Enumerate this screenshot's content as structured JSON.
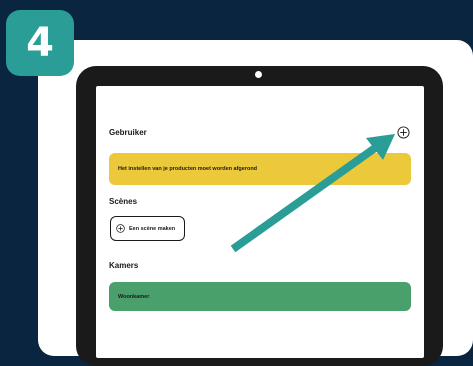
{
  "step": {
    "number": "4"
  },
  "screen": {
    "user_section_title": "Gebruiker",
    "setup_banner": "Het instellen van je producten moet worden afgerond",
    "scenes_title": "Scènes",
    "create_scene_label": "Een scène maken",
    "rooms_title": "Kamers",
    "rooms": [
      {
        "name": "Woonkamer"
      }
    ]
  },
  "icons": {
    "add": "plus-circle-icon",
    "create_scene": "plus-circle-icon",
    "pointer": "arrow-icon"
  },
  "colors": {
    "background": "#0a2540",
    "badge": "#2a9d96",
    "banner": "#ecc93a",
    "room": "#4aa06a",
    "arrow": "#2a9d96"
  }
}
